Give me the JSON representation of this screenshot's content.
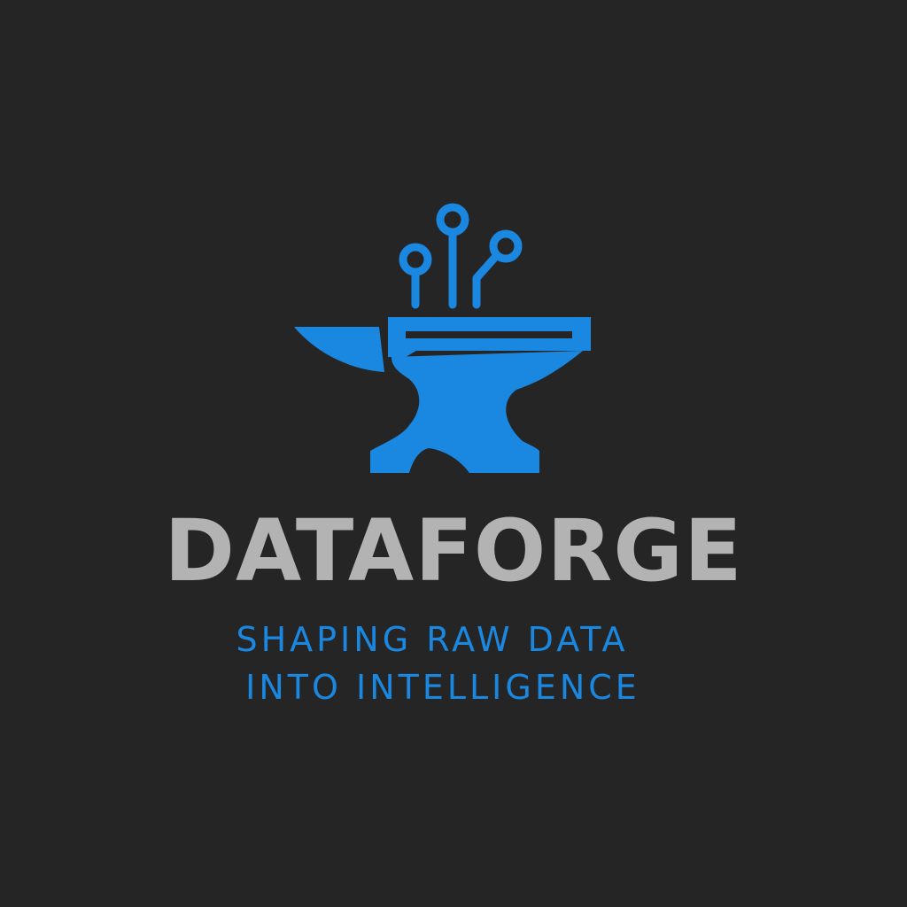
{
  "logo": {
    "name": "DATAFORGE",
    "tagline_lines": [
      "SHAPING RAW DATA",
      "INTO INTELLIGENCE"
    ],
    "mark_icon": "anvil-with-circuit-nodes-icon"
  },
  "colors": {
    "background": "#252525",
    "accent": "#1a87e0",
    "name_text": "#b3b3b3"
  }
}
